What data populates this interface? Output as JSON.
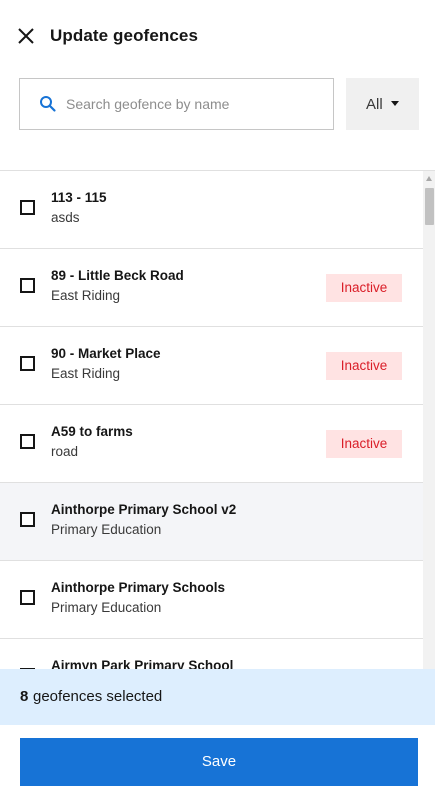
{
  "header": {
    "title": "Update geofences",
    "close_icon": "close-icon"
  },
  "search": {
    "placeholder": "Search geofence by name",
    "value": "",
    "icon": "search-icon"
  },
  "filter": {
    "selected": "All",
    "icon": "caret-down-icon"
  },
  "geofences": [
    {
      "name": "113 - 115",
      "category": "asds",
      "status": "",
      "checked": false
    },
    {
      "name": "89 - Little Beck Road",
      "category": "East Riding",
      "status": "Inactive",
      "checked": false
    },
    {
      "name": "90 - Market Place",
      "category": "East Riding",
      "status": "Inactive",
      "checked": false
    },
    {
      "name": "A59 to farms",
      "category": "road",
      "status": "Inactive",
      "checked": false
    },
    {
      "name": "Ainthorpe Primary School v2",
      "category": "Primary Education",
      "status": "",
      "checked": false
    },
    {
      "name": "Ainthorpe Primary Schools",
      "category": "Primary Education",
      "status": "",
      "checked": false
    },
    {
      "name": "Airmyn Park Primary School",
      "category": "",
      "status": "",
      "checked": false
    }
  ],
  "selection": {
    "count": "8",
    "label": "geofences selected"
  },
  "actions": {
    "save_label": "Save"
  },
  "colors": {
    "primary": "#1773d6",
    "inactive_text": "#da1e28",
    "inactive_bg": "#ffe3e3",
    "banner_bg": "#ddeefe",
    "search_icon": "#1773d6"
  }
}
